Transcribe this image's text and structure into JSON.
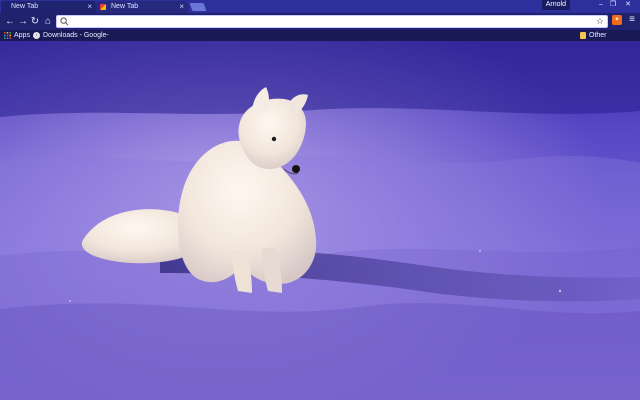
{
  "browser": {
    "tabs": [
      {
        "label": "New Tab",
        "state": "active"
      },
      {
        "label": "New Tab",
        "state": "inactive"
      }
    ],
    "profile_name": "Arnold",
    "address_bar": {
      "value": "",
      "placeholder": ""
    },
    "bookmarks": {
      "apps_label": "Apps",
      "downloads_label": "Downloads - Google-",
      "other_label": "Other bookmarks"
    },
    "theme": {
      "tabstrip": "#2c2f9c",
      "toolbar": "#20226d",
      "bookmark_bar": "#191a55",
      "accent_ext": "#f16b1a"
    }
  },
  "content": {
    "type": "theme-background-photo",
    "subject": "arctic-fox"
  }
}
